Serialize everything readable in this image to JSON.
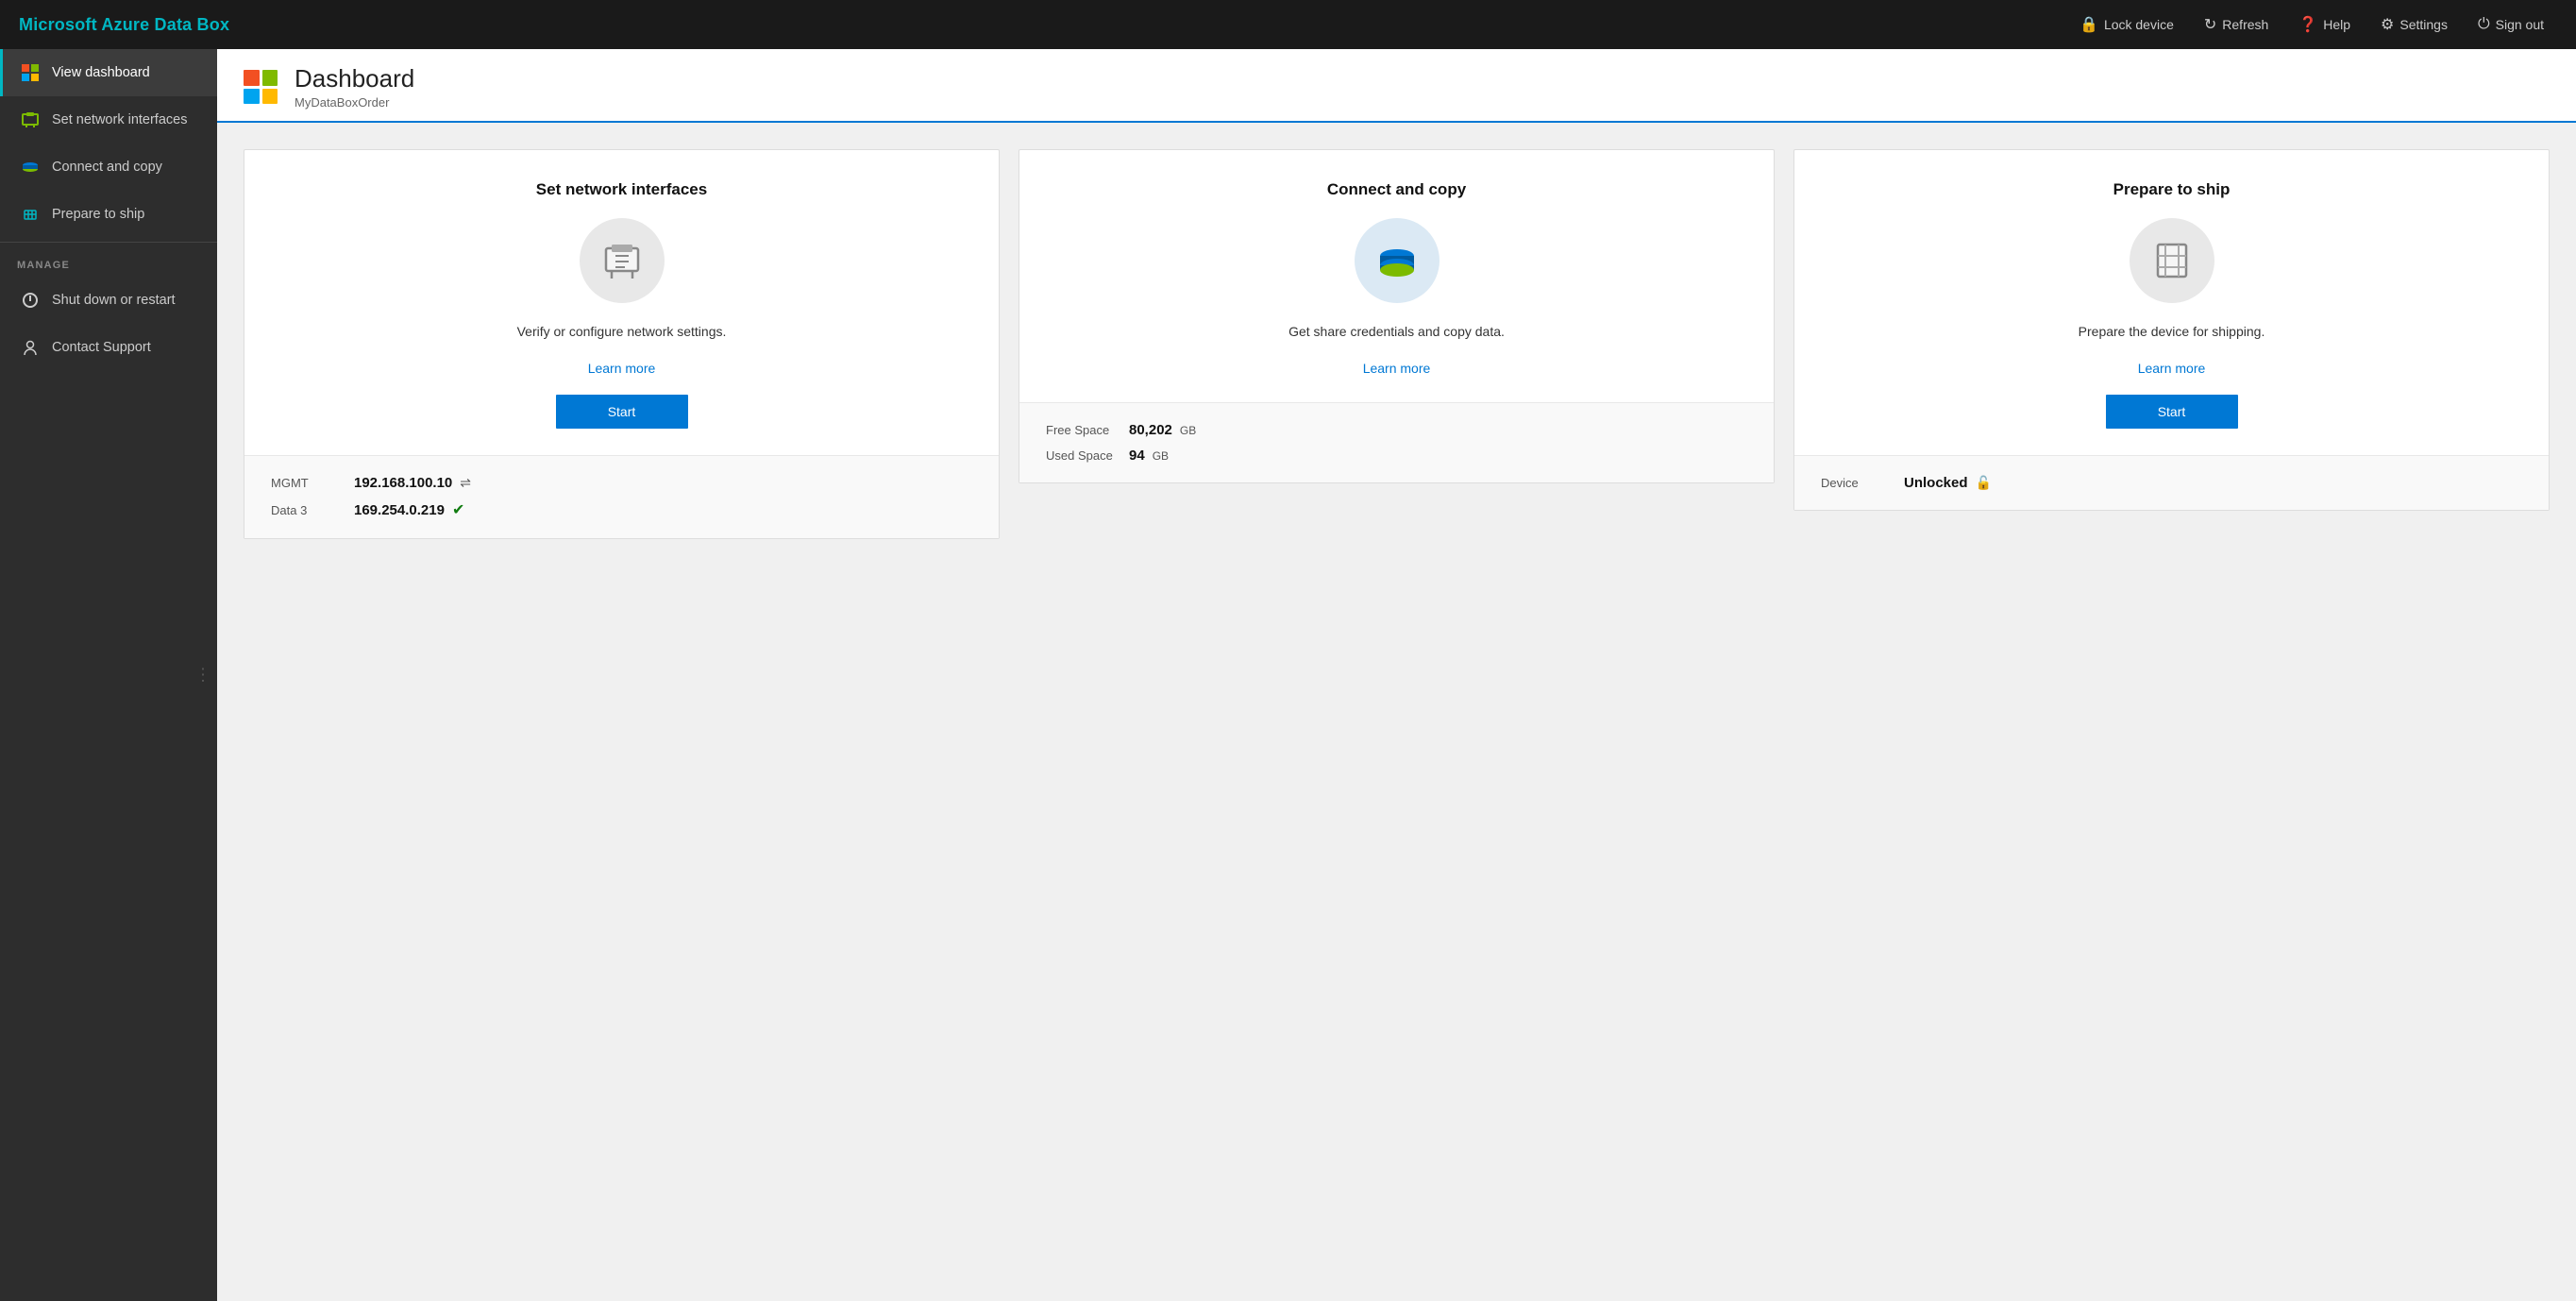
{
  "brand": "Microsoft Azure Data Box",
  "topbar": {
    "lock_label": "Lock device",
    "refresh_label": "Refresh",
    "help_label": "Help",
    "settings_label": "Settings",
    "signout_label": "Sign out"
  },
  "sidebar": {
    "items": [
      {
        "id": "view-dashboard",
        "label": "View dashboard",
        "active": true
      },
      {
        "id": "set-network-interfaces",
        "label": "Set network interfaces",
        "active": false
      },
      {
        "id": "connect-and-copy",
        "label": "Connect and copy",
        "active": false
      },
      {
        "id": "prepare-to-ship",
        "label": "Prepare to ship",
        "active": false
      }
    ],
    "manage_section": "MANAGE",
    "manage_items": [
      {
        "id": "shut-down-restart",
        "label": "Shut down or restart"
      },
      {
        "id": "contact-support",
        "label": "Contact Support"
      }
    ]
  },
  "dashboard": {
    "title": "Dashboard",
    "subtitle": "MyDataBoxOrder",
    "cards": [
      {
        "id": "network",
        "title": "Set network interfaces",
        "description": "Verify or configure network settings.",
        "learn_more": "Learn more",
        "start_label": "Start",
        "stats": [
          {
            "label": "MGMT",
            "value": "192.168.100.10",
            "extra": "⇌",
            "badge": ""
          },
          {
            "label": "Data 3",
            "value": "169.254.0.219",
            "extra": "",
            "badge": "✔"
          }
        ]
      },
      {
        "id": "copy",
        "title": "Connect and copy",
        "description": "Get share credentials and copy data.",
        "learn_more": "Learn more",
        "start_label": null,
        "stats": [
          {
            "label": "Free Space",
            "value": "80,202",
            "unit": "GB",
            "badge": ""
          },
          {
            "label": "Used Space",
            "value": "94",
            "unit": "GB",
            "badge": ""
          }
        ]
      },
      {
        "id": "ship",
        "title": "Prepare to ship",
        "description": "Prepare the device for shipping.",
        "learn_more": "Learn more",
        "start_label": "Start",
        "stats": [
          {
            "label": "Device",
            "value": "Unlocked",
            "icon": "🔓",
            "badge": ""
          }
        ]
      }
    ]
  }
}
